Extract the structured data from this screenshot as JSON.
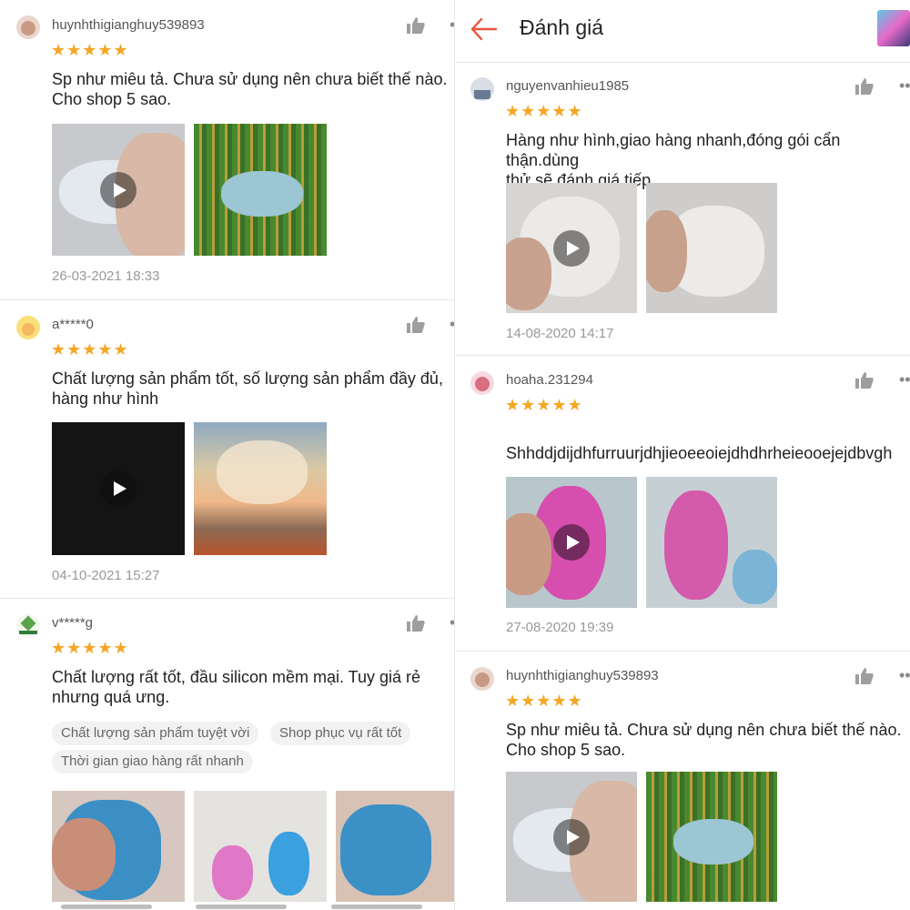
{
  "app": {
    "title": "Đánh giá"
  },
  "colors": {
    "star": "#f5a623",
    "back_arrow": "#e8553b",
    "date": "#999999"
  },
  "left": {
    "reviews": [
      {
        "user": "huynhthigianghuy539893",
        "rating": 5,
        "stars": "★★★★★",
        "text": "Sp như miêu tả. Chưa sử dụng nên chưa biết thế nào.\nCho shop 5 sao.",
        "date": "26-03-2021 18:33"
      },
      {
        "user": "a*****0",
        "rating": 5,
        "stars": "★★★★★",
        "text": "Chất lượng sản phẩm tốt, số lượng sản phẩm đầy đủ,\nhàng như hình",
        "date": "04-10-2021 15:27"
      },
      {
        "user": "v*****g",
        "rating": 5,
        "stars": "★★★★★",
        "text": "Chất lượng rất tốt, đầu silicon mềm mại. Tuy giá rẻ\nnhưng quá ưng.",
        "tags": [
          "Chất lượng sản phẩm tuyệt vời",
          "Shop phục vụ rất tốt",
          "Thời gian giao hàng rất nhanh"
        ]
      }
    ]
  },
  "right": {
    "reviews": [
      {
        "user": "nguyenvanhieu1985",
        "rating": 5,
        "stars": "★★★★★",
        "text": "Hàng như hình,giao hàng nhanh,đóng gói cẩn thận.dùng\nthử sẽ đánh giá tiếp",
        "date": "14-08-2020 14:17"
      },
      {
        "user": "hoaha.231294",
        "rating": 5,
        "stars": "★★★★★",
        "text": "Shhddjdijdhfurruurjdhjieoeeoiejdhdhrheieooejejdbvgh",
        "date": "27-08-2020 19:39"
      },
      {
        "user": "huynhthigianghuy539893",
        "rating": 5,
        "stars": "★★★★★",
        "text": "Sp như miêu tả. Chưa sử dụng nên chưa biết thế nào.\nCho shop 5 sao."
      }
    ]
  },
  "icons": {
    "back": "arrow-left-icon",
    "like": "thumbs-up-icon",
    "more": "more-dots-icon",
    "play": "play-icon"
  }
}
